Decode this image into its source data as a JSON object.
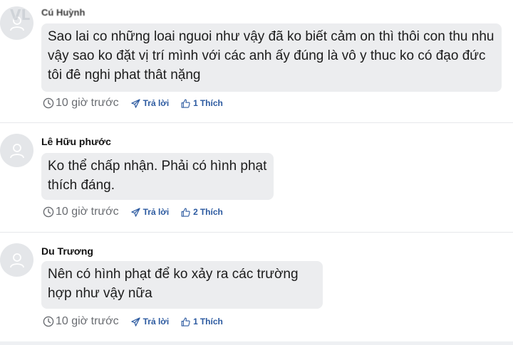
{
  "comments": [
    {
      "author": "Cú Huỳnh",
      "lines": [
        "Sao lai co những loai nguoi như vậy đã ko biết cảm on thì thôi con thu nhu",
        "vậy sao ko đặt vị trí mình với các anh ấy đúng là vô y thuc ko có đạo đức",
        "tôi đê nghi phat thât nặng"
      ],
      "time": "10 giờ trước",
      "reply_label": "Trả lời",
      "like_count": "1",
      "like_label": "Thích"
    },
    {
      "author": "Lê Hữu phước",
      "lines": [
        "Ko thể chấp nhận. Phải có hình phạt",
        "thích đáng."
      ],
      "time": "10 giờ trước",
      "reply_label": "Trả lời",
      "like_count": "2",
      "like_label": "Thích"
    },
    {
      "author": "Du Trương",
      "lines": [
        "Nên có hình phạt để ko xảy ra các trường",
        "hợp như vậy nữa"
      ],
      "time": "10 giờ trước",
      "reply_label": "Trả lời",
      "like_count": "1",
      "like_label": "Thích"
    }
  ],
  "icons": {
    "avatar": "user-icon",
    "time": "clock-icon",
    "reply": "paper-plane-icon",
    "like": "thumbs-up-icon"
  },
  "colors": {
    "bubble_bg": "#ecedef",
    "avatar_bg": "#e4e6e9",
    "action_text": "#2c5aa0",
    "meta_text": "#6a6d72",
    "divider": "#e6e8eb"
  }
}
